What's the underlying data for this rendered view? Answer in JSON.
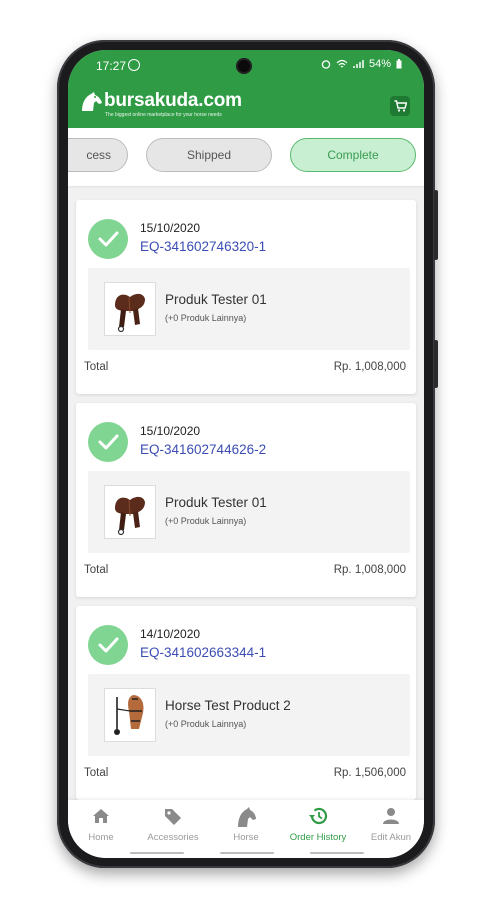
{
  "status_bar": {
    "time": "17:27",
    "battery": "54%"
  },
  "app_bar": {
    "brand": "bursakuda.com",
    "tagline": "The biggest online marketplace for your horse needs",
    "cart_icon": "cart-icon"
  },
  "filters": {
    "chips": [
      {
        "label": "cess",
        "active": false
      },
      {
        "label": "Shipped",
        "active": false
      },
      {
        "label": "Complete",
        "active": true
      }
    ]
  },
  "orders": [
    {
      "date": "15/10/2020",
      "order_id": "EQ-341602746320-1",
      "product_name": "Produk Tester 01",
      "product_sub": "(+0 Produk Lainnya)",
      "product_image": "saddle",
      "total_label": "Total",
      "total_value": "Rp. 1,008,000"
    },
    {
      "date": "15/10/2020",
      "order_id": "EQ-341602744626-2",
      "product_name": "Produk Tester 01",
      "product_sub": "(+0 Produk Lainnya)",
      "product_image": "saddle",
      "total_label": "Total",
      "total_value": "Rp. 1,008,000"
    },
    {
      "date": "14/10/2020",
      "order_id": "EQ-341602663344-1",
      "product_name": "Horse Test Product 2",
      "product_sub": "(+0 Produk Lainnya)",
      "product_image": "bridle",
      "total_label": "Total",
      "total_value": "Rp. 1,506,000"
    }
  ],
  "bottom_nav": [
    {
      "label": "Home",
      "icon": "home-icon",
      "active": false
    },
    {
      "label": "Accessories",
      "icon": "tag-icon",
      "active": false
    },
    {
      "label": "Horse",
      "icon": "horse-icon",
      "active": false
    },
    {
      "label": "Order History",
      "icon": "history-icon",
      "active": true
    },
    {
      "label": "Edit Akun",
      "icon": "user-icon",
      "active": false
    }
  ],
  "colors": {
    "brand_green": "#2f9c45",
    "check_green": "#7fd591",
    "link_blue": "#3b4db3"
  }
}
